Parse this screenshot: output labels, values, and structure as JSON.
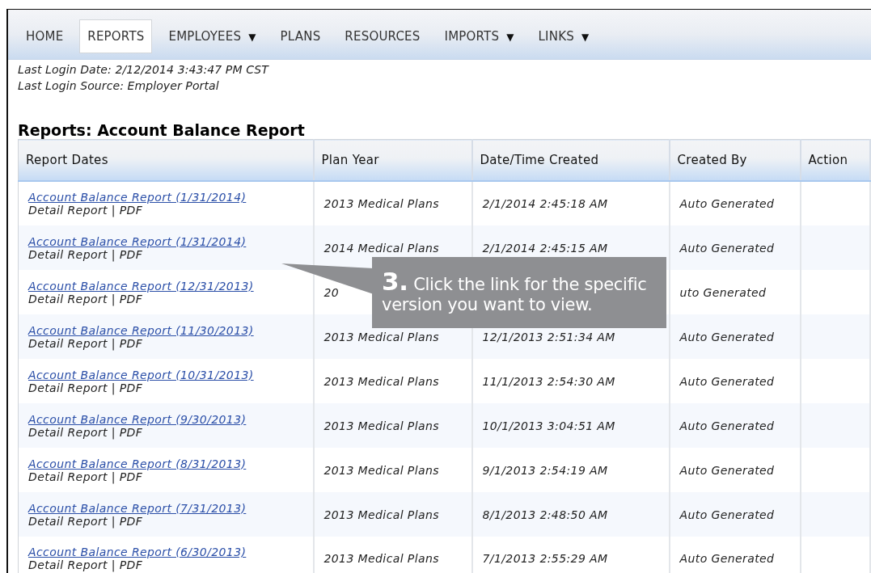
{
  "nav": {
    "items": [
      {
        "label": "HOME",
        "selected": false
      },
      {
        "label": "REPORTS",
        "selected": true
      },
      {
        "label": "EMPLOYEES",
        "selected": false,
        "caret": "▼"
      },
      {
        "label": "PLANS",
        "selected": false
      },
      {
        "label": "RESOURCES",
        "selected": false
      },
      {
        "label": "IMPORTS",
        "selected": false,
        "caret": "▼"
      },
      {
        "label": "LINKS",
        "selected": false,
        "caret": "▼"
      }
    ]
  },
  "login_info": [
    "Last Login Date: 2/12/2014 3:43:47 PM CST",
    "Last Login Source: Employer Portal"
  ],
  "title": "Reports: Account Balance Report",
  "table": {
    "columns": [
      "Report Dates",
      "Plan Year",
      "Date/Time Created",
      "Created By",
      "Action"
    ],
    "rows": [
      {
        "link": "Account Balance Report (1/31/2014)",
        "detail": "Detail Report | PDF",
        "plan_year": "2013 Medical Plans",
        "created": "2/1/2014 2:45:18 AM",
        "created_by": "Auto Generated"
      },
      {
        "link": "Account Balance Report (1/31/2014)",
        "detail": "Detail Report | PDF",
        "plan_year": "2014 Medical Plans",
        "created": "2/1/2014 2:45:15 AM",
        "created_by": "Auto Generated"
      },
      {
        "link": "Account Balance Report (12/31/2013)",
        "detail": "Detail Report | PDF",
        "plan_year": "20",
        "created_by": "uto Generated"
      },
      {
        "link": "Account Balance Report (11/30/2013)",
        "detail": "Detail Report | PDF",
        "plan_year": "2013 Medical Plans",
        "created": "12/1/2013 2:51:34 AM",
        "created_by": "Auto Generated"
      },
      {
        "link": "Account Balance Report (10/31/2013)",
        "detail": "Detail Report | PDF",
        "plan_year": "2013 Medical Plans",
        "created": "11/1/2013 2:54:30 AM",
        "created_by": "Auto Generated"
      },
      {
        "link": "Account Balance Report (9/30/2013)",
        "detail": "Detail Report | PDF",
        "plan_year": "2013 Medical Plans",
        "created": "10/1/2013 3:04:51 AM",
        "created_by": "Auto Generated"
      },
      {
        "link": "Account Balance Report (8/31/2013)",
        "detail": "Detail Report | PDF",
        "plan_year": "2013 Medical Plans",
        "created": "9/1/2013 2:54:19 AM",
        "created_by": "Auto Generated"
      },
      {
        "link": "Account Balance Report (7/31/2013)",
        "detail": "Detail Report | PDF",
        "plan_year": "2013 Medical Plans",
        "created": "8/1/2013 2:48:50 AM",
        "created_by": "Auto Generated"
      },
      {
        "link": "Account Balance Report (6/30/2013)",
        "detail": "Detail Report | PDF",
        "plan_year": "2013 Medical Plans",
        "created": "7/1/2013 2:55:29 AM",
        "created_by": "Auto Generated"
      }
    ]
  },
  "callout": {
    "text": "**3.** Click the link for the specific version you want to view."
  }
}
